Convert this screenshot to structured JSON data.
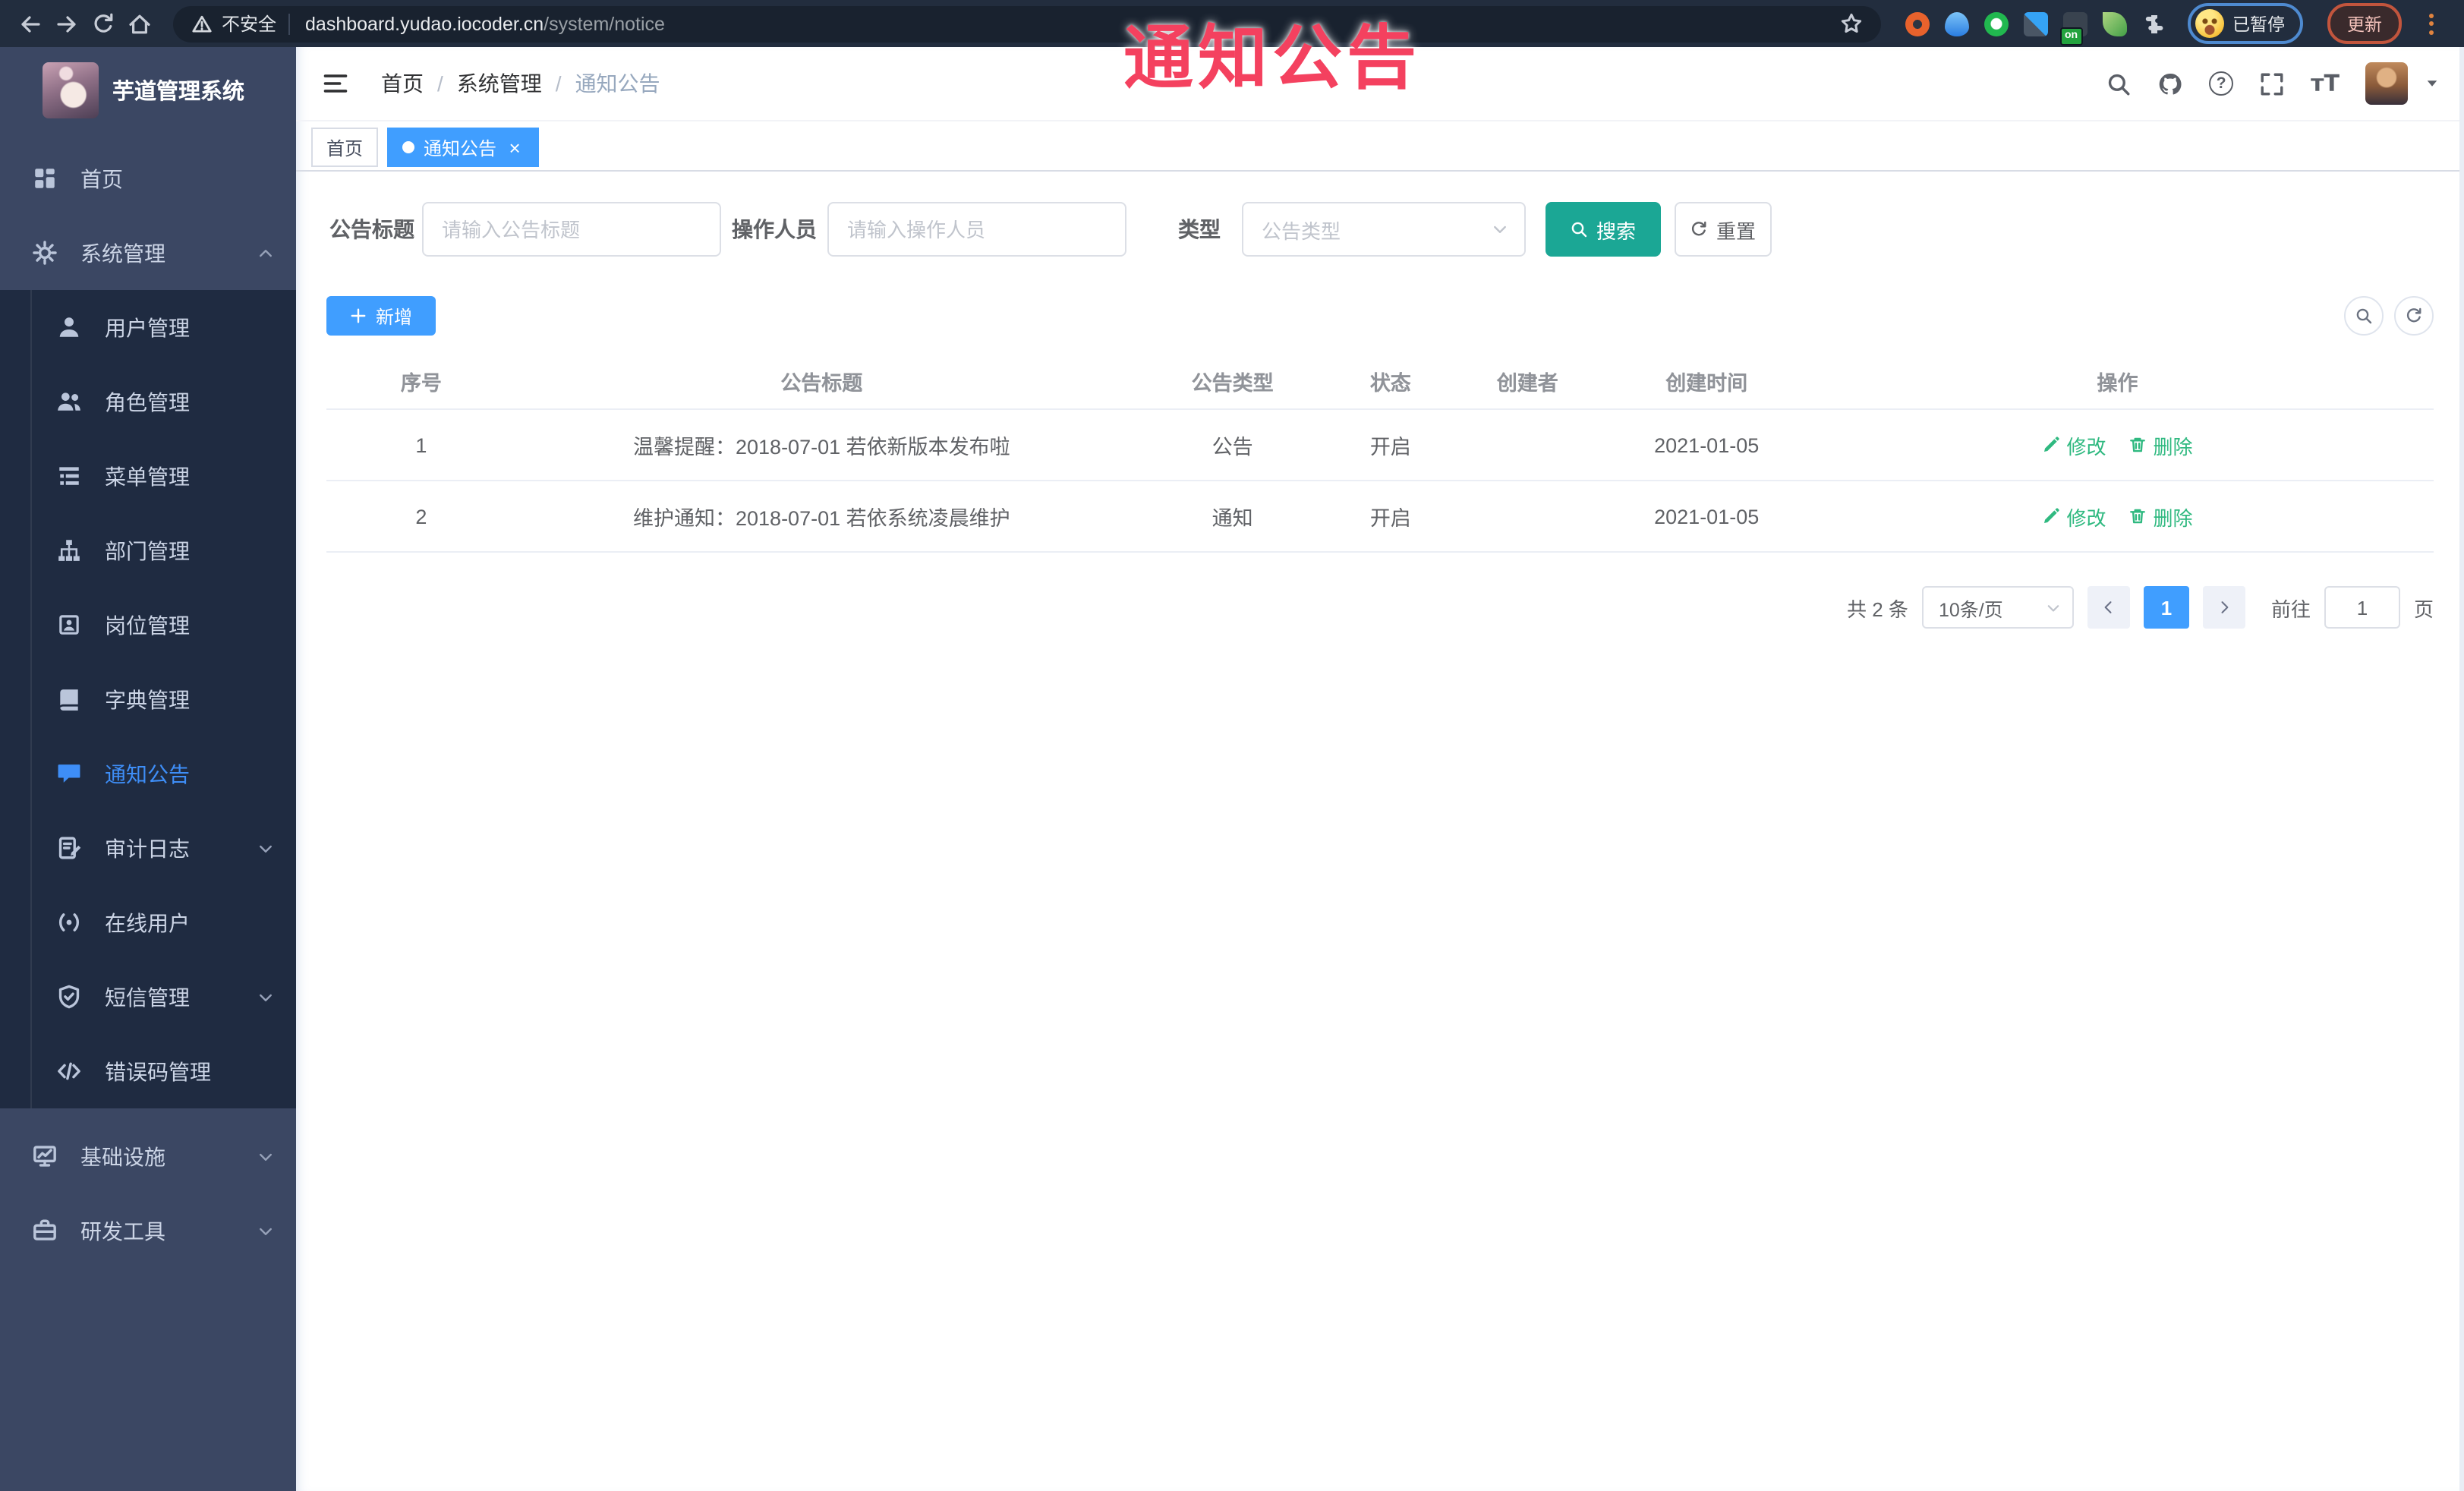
{
  "browser": {
    "security_label": "不安全",
    "url_host": "dashboard.yudao.iocoder.cn",
    "url_path": "/system/notice",
    "extension_badge": "on",
    "profile_status_label": "已暂停",
    "update_button_label": "更新",
    "nav_icons": [
      "back-icon",
      "forward-icon",
      "reload-icon",
      "home-icon"
    ],
    "extension_icons": [
      "lifebuoy-extension-icon",
      "drop-extension-icon",
      "vue-devtools-icon",
      "grid-extension-icon",
      "switch-extension-icon",
      "leaf-extension-icon",
      "puzzle-icon"
    ]
  },
  "annotation": {
    "text": "通知公告",
    "color": "#f4415f"
  },
  "sidebar": {
    "title": "芋道管理系统",
    "items": [
      {
        "name": "home",
        "label": "首页",
        "icon": "dashboard-icon",
        "level": "top"
      },
      {
        "name": "system-mgmt",
        "label": "系统管理",
        "icon": "gear-icon",
        "level": "top",
        "chevron": "up",
        "expanded": true
      },
      {
        "name": "user-mgmt",
        "label": "用户管理",
        "icon": "user-icon",
        "level": "sub"
      },
      {
        "name": "role-mgmt",
        "label": "角色管理",
        "icon": "users-icon",
        "level": "sub"
      },
      {
        "name": "menu-mgmt",
        "label": "菜单管理",
        "icon": "tree-table-icon",
        "level": "sub"
      },
      {
        "name": "dept-mgmt",
        "label": "部门管理",
        "icon": "org-icon",
        "level": "sub"
      },
      {
        "name": "post-mgmt",
        "label": "岗位管理",
        "icon": "badge-icon",
        "level": "sub"
      },
      {
        "name": "dict-mgmt",
        "label": "字典管理",
        "icon": "book-icon",
        "level": "sub"
      },
      {
        "name": "notice",
        "label": "通知公告",
        "icon": "message-icon",
        "level": "sub",
        "active": true
      },
      {
        "name": "audit-log",
        "label": "审计日志",
        "icon": "log-icon",
        "level": "sub",
        "chevron": "down"
      },
      {
        "name": "online-users",
        "label": "在线用户",
        "icon": "online-icon",
        "level": "sub"
      },
      {
        "name": "sms-mgmt",
        "label": "短信管理",
        "icon": "shield-icon",
        "level": "sub",
        "chevron": "down"
      },
      {
        "name": "errcode-mgmt",
        "label": "错误码管理",
        "icon": "code-icon",
        "level": "sub"
      },
      {
        "name": "infrastructure",
        "label": "基础设施",
        "icon": "monitor-icon",
        "level": "top",
        "chevron": "down",
        "gap": true
      },
      {
        "name": "dev-tools",
        "label": "研发工具",
        "icon": "toolbox-icon",
        "level": "top",
        "chevron": "down"
      }
    ]
  },
  "header": {
    "breadcrumb": [
      {
        "label": "首页"
      },
      {
        "label": "系统管理"
      },
      {
        "label": "通知公告",
        "current": true
      }
    ],
    "icons": [
      "search-icon",
      "github-icon",
      "help-icon",
      "fullscreen-icon",
      "font-size-icon",
      "avatar",
      "caret-down-icon"
    ]
  },
  "tabs": [
    {
      "label": "首页",
      "active": false
    },
    {
      "label": "通知公告",
      "active": true,
      "closable": true
    }
  ],
  "filters": {
    "title_label": "公告标题",
    "title_placeholder": "请输入公告标题",
    "title_value": "",
    "operator_label": "操作人员",
    "operator_placeholder": "请输入操作人员",
    "operator_value": "",
    "type_label": "类型",
    "type_placeholder": "公告类型",
    "search_label": "搜索",
    "reset_label": "重置"
  },
  "toolbar": {
    "add_label": "新增"
  },
  "table": {
    "columns": [
      "序号",
      "公告标题",
      "公告类型",
      "状态",
      "创建者",
      "创建时间",
      "操作"
    ],
    "rows": [
      {
        "no": "1",
        "title": "温馨提醒：2018-07-01 若依新版本发布啦",
        "type": "公告",
        "status": "开启",
        "creator": "",
        "created": "2021-01-05"
      },
      {
        "no": "2",
        "title": "维护通知：2018-07-01 若依系统凌晨维护",
        "type": "通知",
        "status": "开启",
        "creator": "",
        "created": "2021-01-05"
      }
    ],
    "edit_label": "修改",
    "delete_label": "删除"
  },
  "pagination": {
    "total_label": "共 2 条",
    "page_size_label": "10条/页",
    "current_page": "1",
    "goto_label": "前往",
    "goto_value": "1",
    "page_unit_label": "页"
  }
}
